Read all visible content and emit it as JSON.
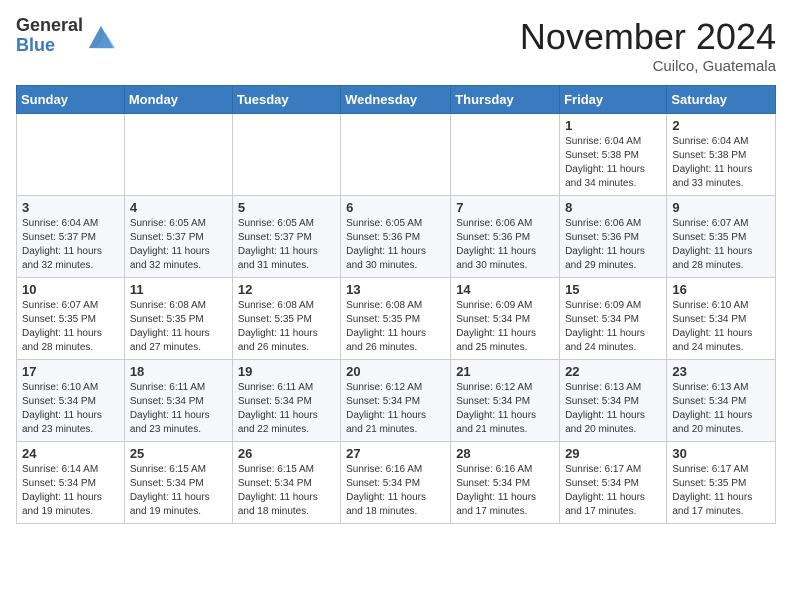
{
  "header": {
    "logo_general": "General",
    "logo_blue": "Blue",
    "month_title": "November 2024",
    "location": "Cuilco, Guatemala"
  },
  "days_of_week": [
    "Sunday",
    "Monday",
    "Tuesday",
    "Wednesday",
    "Thursday",
    "Friday",
    "Saturday"
  ],
  "weeks": [
    [
      {
        "day": "",
        "info": ""
      },
      {
        "day": "",
        "info": ""
      },
      {
        "day": "",
        "info": ""
      },
      {
        "day": "",
        "info": ""
      },
      {
        "day": "",
        "info": ""
      },
      {
        "day": "1",
        "info": "Sunrise: 6:04 AM\nSunset: 5:38 PM\nDaylight: 11 hours and 34 minutes."
      },
      {
        "day": "2",
        "info": "Sunrise: 6:04 AM\nSunset: 5:38 PM\nDaylight: 11 hours and 33 minutes."
      }
    ],
    [
      {
        "day": "3",
        "info": "Sunrise: 6:04 AM\nSunset: 5:37 PM\nDaylight: 11 hours and 32 minutes."
      },
      {
        "day": "4",
        "info": "Sunrise: 6:05 AM\nSunset: 5:37 PM\nDaylight: 11 hours and 32 minutes."
      },
      {
        "day": "5",
        "info": "Sunrise: 6:05 AM\nSunset: 5:37 PM\nDaylight: 11 hours and 31 minutes."
      },
      {
        "day": "6",
        "info": "Sunrise: 6:05 AM\nSunset: 5:36 PM\nDaylight: 11 hours and 30 minutes."
      },
      {
        "day": "7",
        "info": "Sunrise: 6:06 AM\nSunset: 5:36 PM\nDaylight: 11 hours and 30 minutes."
      },
      {
        "day": "8",
        "info": "Sunrise: 6:06 AM\nSunset: 5:36 PM\nDaylight: 11 hours and 29 minutes."
      },
      {
        "day": "9",
        "info": "Sunrise: 6:07 AM\nSunset: 5:35 PM\nDaylight: 11 hours and 28 minutes."
      }
    ],
    [
      {
        "day": "10",
        "info": "Sunrise: 6:07 AM\nSunset: 5:35 PM\nDaylight: 11 hours and 28 minutes."
      },
      {
        "day": "11",
        "info": "Sunrise: 6:08 AM\nSunset: 5:35 PM\nDaylight: 11 hours and 27 minutes."
      },
      {
        "day": "12",
        "info": "Sunrise: 6:08 AM\nSunset: 5:35 PM\nDaylight: 11 hours and 26 minutes."
      },
      {
        "day": "13",
        "info": "Sunrise: 6:08 AM\nSunset: 5:35 PM\nDaylight: 11 hours and 26 minutes."
      },
      {
        "day": "14",
        "info": "Sunrise: 6:09 AM\nSunset: 5:34 PM\nDaylight: 11 hours and 25 minutes."
      },
      {
        "day": "15",
        "info": "Sunrise: 6:09 AM\nSunset: 5:34 PM\nDaylight: 11 hours and 24 minutes."
      },
      {
        "day": "16",
        "info": "Sunrise: 6:10 AM\nSunset: 5:34 PM\nDaylight: 11 hours and 24 minutes."
      }
    ],
    [
      {
        "day": "17",
        "info": "Sunrise: 6:10 AM\nSunset: 5:34 PM\nDaylight: 11 hours and 23 minutes."
      },
      {
        "day": "18",
        "info": "Sunrise: 6:11 AM\nSunset: 5:34 PM\nDaylight: 11 hours and 23 minutes."
      },
      {
        "day": "19",
        "info": "Sunrise: 6:11 AM\nSunset: 5:34 PM\nDaylight: 11 hours and 22 minutes."
      },
      {
        "day": "20",
        "info": "Sunrise: 6:12 AM\nSunset: 5:34 PM\nDaylight: 11 hours and 21 minutes."
      },
      {
        "day": "21",
        "info": "Sunrise: 6:12 AM\nSunset: 5:34 PM\nDaylight: 11 hours and 21 minutes."
      },
      {
        "day": "22",
        "info": "Sunrise: 6:13 AM\nSunset: 5:34 PM\nDaylight: 11 hours and 20 minutes."
      },
      {
        "day": "23",
        "info": "Sunrise: 6:13 AM\nSunset: 5:34 PM\nDaylight: 11 hours and 20 minutes."
      }
    ],
    [
      {
        "day": "24",
        "info": "Sunrise: 6:14 AM\nSunset: 5:34 PM\nDaylight: 11 hours and 19 minutes."
      },
      {
        "day": "25",
        "info": "Sunrise: 6:15 AM\nSunset: 5:34 PM\nDaylight: 11 hours and 19 minutes."
      },
      {
        "day": "26",
        "info": "Sunrise: 6:15 AM\nSunset: 5:34 PM\nDaylight: 11 hours and 18 minutes."
      },
      {
        "day": "27",
        "info": "Sunrise: 6:16 AM\nSunset: 5:34 PM\nDaylight: 11 hours and 18 minutes."
      },
      {
        "day": "28",
        "info": "Sunrise: 6:16 AM\nSunset: 5:34 PM\nDaylight: 11 hours and 17 minutes."
      },
      {
        "day": "29",
        "info": "Sunrise: 6:17 AM\nSunset: 5:34 PM\nDaylight: 11 hours and 17 minutes."
      },
      {
        "day": "30",
        "info": "Sunrise: 6:17 AM\nSunset: 5:35 PM\nDaylight: 11 hours and 17 minutes."
      }
    ]
  ]
}
